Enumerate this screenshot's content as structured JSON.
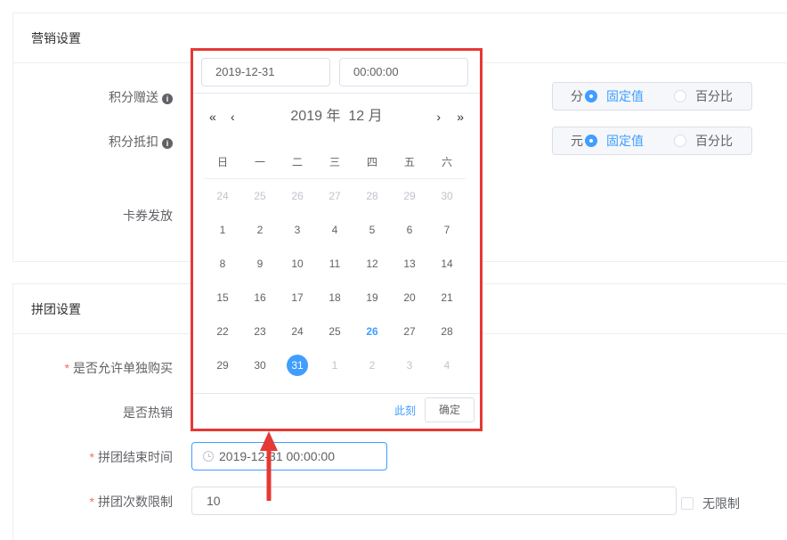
{
  "marketing": {
    "title": "营销设置",
    "points_gift": {
      "label": "积分赠送",
      "unit": "分",
      "option_fixed": "固定值",
      "option_percent": "百分比"
    },
    "points_deduct": {
      "label": "积分抵扣",
      "unit": "元",
      "option_fixed": "固定值",
      "option_percent": "百分比"
    },
    "coupon": {
      "label": "卡券发放"
    }
  },
  "group": {
    "title": "拼团设置",
    "solo_buy": {
      "label": "是否允许单独购买",
      "required_mark": "*"
    },
    "hot": {
      "label": "是否热销"
    },
    "end_time": {
      "label": "拼团结束时间",
      "required_mark": "*",
      "value": "2019-12-31 00:00:00"
    },
    "limit": {
      "label": "拼团次数限制",
      "required_mark": "*",
      "value": "10",
      "unlimited_label": "无限制"
    }
  },
  "picker": {
    "date_value": "2019-12-31",
    "time_value": "00:00:00",
    "prev_year": "«",
    "prev_month": "‹",
    "next_month": "›",
    "next_year": "»",
    "year_label": "2019 年",
    "month_label": "12 月",
    "weekdays": [
      "日",
      "一",
      "二",
      "三",
      "四",
      "五",
      "六"
    ],
    "weeks": [
      [
        {
          "d": "24",
          "t": "other"
        },
        {
          "d": "25",
          "t": "other"
        },
        {
          "d": "26",
          "t": "other"
        },
        {
          "d": "27",
          "t": "other"
        },
        {
          "d": "28",
          "t": "other"
        },
        {
          "d": "29",
          "t": "other"
        },
        {
          "d": "30",
          "t": "other"
        }
      ],
      [
        {
          "d": "1",
          "t": ""
        },
        {
          "d": "2",
          "t": ""
        },
        {
          "d": "3",
          "t": ""
        },
        {
          "d": "4",
          "t": ""
        },
        {
          "d": "5",
          "t": ""
        },
        {
          "d": "6",
          "t": ""
        },
        {
          "d": "7",
          "t": ""
        }
      ],
      [
        {
          "d": "8",
          "t": ""
        },
        {
          "d": "9",
          "t": ""
        },
        {
          "d": "10",
          "t": ""
        },
        {
          "d": "11",
          "t": ""
        },
        {
          "d": "12",
          "t": ""
        },
        {
          "d": "13",
          "t": ""
        },
        {
          "d": "14",
          "t": ""
        }
      ],
      [
        {
          "d": "15",
          "t": ""
        },
        {
          "d": "16",
          "t": ""
        },
        {
          "d": "17",
          "t": ""
        },
        {
          "d": "18",
          "t": ""
        },
        {
          "d": "19",
          "t": ""
        },
        {
          "d": "20",
          "t": ""
        },
        {
          "d": "21",
          "t": ""
        }
      ],
      [
        {
          "d": "22",
          "t": ""
        },
        {
          "d": "23",
          "t": ""
        },
        {
          "d": "24",
          "t": ""
        },
        {
          "d": "25",
          "t": ""
        },
        {
          "d": "26",
          "t": "today"
        },
        {
          "d": "27",
          "t": ""
        },
        {
          "d": "28",
          "t": ""
        }
      ],
      [
        {
          "d": "29",
          "t": ""
        },
        {
          "d": "30",
          "t": ""
        },
        {
          "d": "31",
          "t": "selected"
        },
        {
          "d": "1",
          "t": "other"
        },
        {
          "d": "2",
          "t": "other"
        },
        {
          "d": "3",
          "t": "other"
        },
        {
          "d": "4",
          "t": "other"
        }
      ]
    ],
    "now_label": "此刻",
    "ok_label": "确定"
  },
  "colors": {
    "accent": "#409eff",
    "highlight_border": "#e53935",
    "arrow": "#e53935"
  }
}
